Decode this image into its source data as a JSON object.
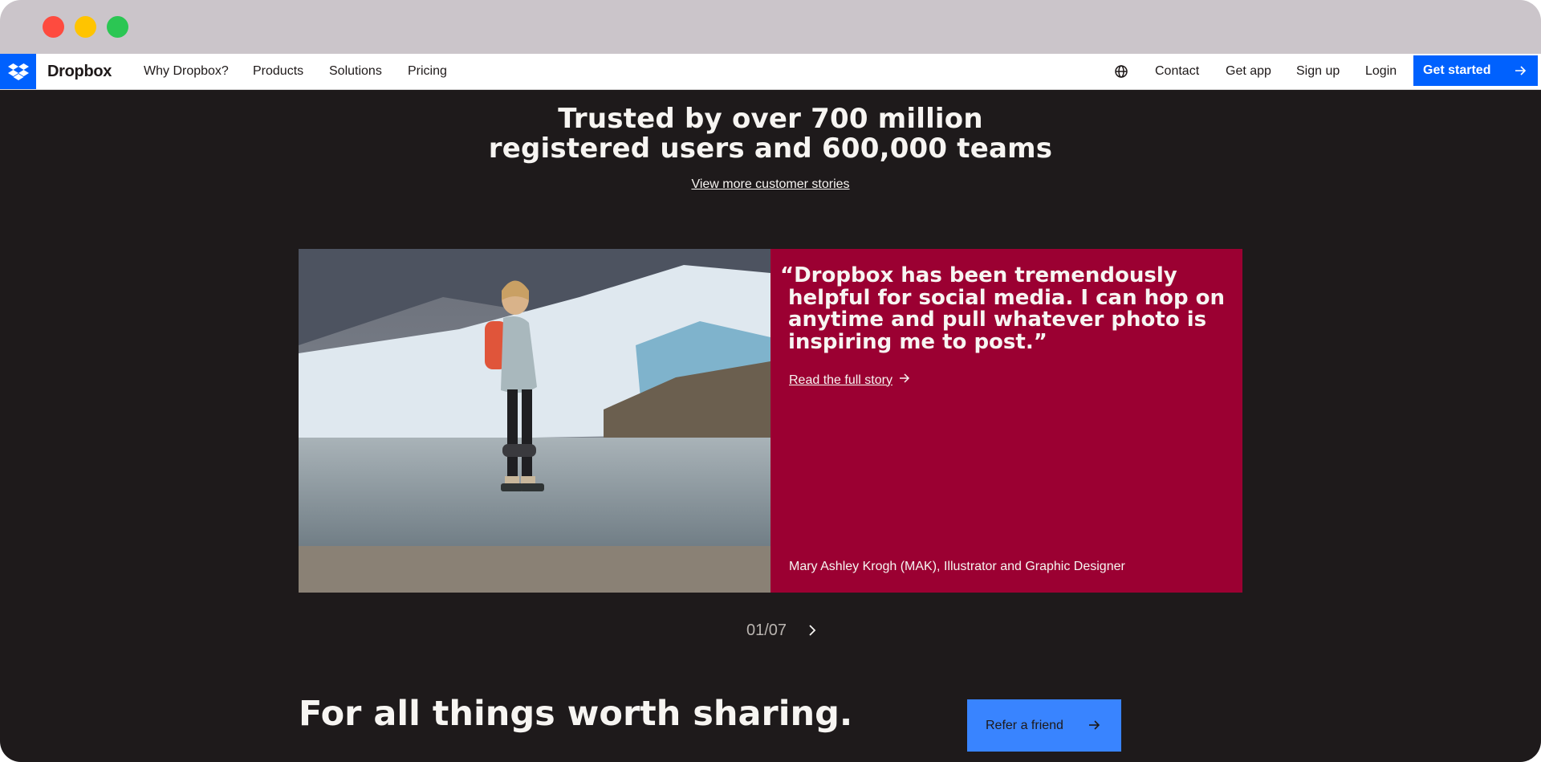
{
  "nav": {
    "brand": "Dropbox",
    "links": [
      "Why Dropbox?",
      "Products",
      "Solutions",
      "Pricing"
    ],
    "right_links": [
      "Contact",
      "Get app",
      "Sign up",
      "Login"
    ],
    "cta": "Get started"
  },
  "hero": {
    "title_line1": "Trusted by over 700 million",
    "title_line2": "registered users and 600,000 teams",
    "stories_link": "View more customer stories"
  },
  "testimonial": {
    "quote_line1": "“Dropbox has been tremendously",
    "quote_line2": "helpful for social media. I can hop on",
    "quote_line3": "anytime and pull whatever photo is",
    "quote_line4": "inspiring me to post.”",
    "read_link": "Read the full story",
    "attribution": "Mary Ashley Krogh (MAK), Illustrator and Graphic Designer"
  },
  "pager": {
    "label": "01/07"
  },
  "footer_cta": {
    "headline": "For all things worth sharing.",
    "button": "Refer a friend"
  },
  "colors": {
    "brand_blue": "#0061fe",
    "page_bg": "#1e1a1b",
    "quote_bg": "#9b0032",
    "refer_bg": "#3984ff"
  }
}
